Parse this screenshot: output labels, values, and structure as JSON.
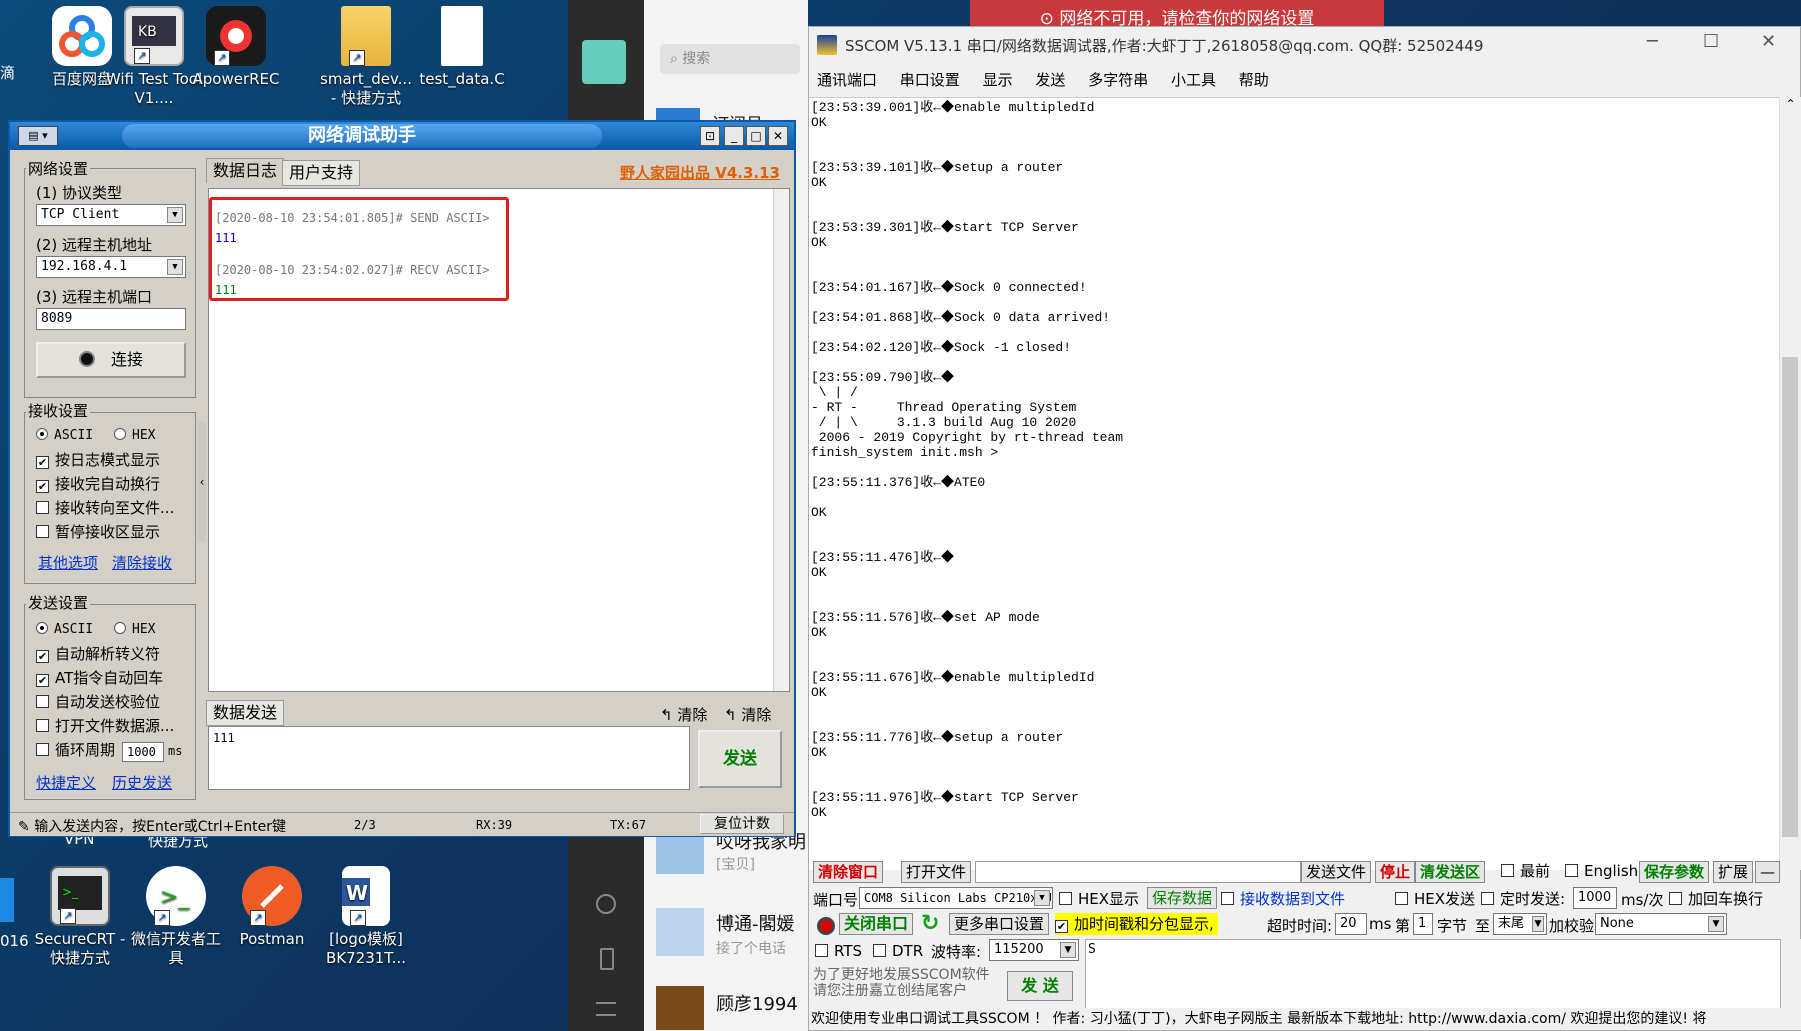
{
  "desktop": {
    "icons": [
      {
        "label": "百度网盘",
        "icon": "baidu-netdisk-icon"
      },
      {
        "label": "Wifi Test Tool V1....",
        "icon": "wifi-tool-icon"
      },
      {
        "label": "ApowerREC",
        "icon": "apowerrec-icon"
      },
      {
        "label": "smart_dev... - 快捷方式",
        "icon": "folder-icon"
      },
      {
        "label": "test_data.C",
        "icon": "file-icon"
      },
      {
        "label": "SecureCRT - 快捷方式",
        "icon": "securecrt-icon"
      },
      {
        "label": "微信开发者工具",
        "icon": "wechat-dev-icon"
      },
      {
        "label": "Postman",
        "icon": "postman-icon"
      },
      {
        "label": "[logo模板] BK7231T...",
        "icon": "word-icon"
      }
    ],
    "partial_labels": {
      "left_top": "滴",
      "vpn": "VPN",
      "shortcut2": "快捷方式",
      "left_bottom": "016"
    },
    "search_placeholder": "搜索",
    "alert": "网络不可用，请检查你的网络设置",
    "chats": [
      {
        "name": "订阅号",
        "preview": ""
      },
      {
        "name": "哎呀我家明",
        "preview": "[宝贝]"
      },
      {
        "name": "博通-閣媛",
        "preview": "接了个电话"
      },
      {
        "name": "顾彦1994",
        "preview": ""
      }
    ]
  },
  "netassist": {
    "title": "网络调试助手",
    "net_settings": "网络设置",
    "protocol_label": "(1) 协议类型",
    "protocol_value": "TCP Client",
    "host_label": "(2) 远程主机地址",
    "host_value": "192.168.4.1",
    "port_label": "(3) 远程主机端口",
    "port_value": "8089",
    "connect": "连接",
    "recv_settings": "接收设置",
    "ascii": "ASCII",
    "hex": "HEX",
    "recv_opts": [
      "按日志模式显示",
      "接收完自动换行",
      "接收转向至文件...",
      "暂停接收区显示"
    ],
    "recv_checked": [
      true,
      true,
      false,
      false
    ],
    "other_opts": "其他选项",
    "clear_recv": "清除接收",
    "send_settings": "发送设置",
    "send_opts": [
      "自动解析转义符",
      "AT指令自动回车",
      "自动发送校验位",
      "打开文件数据源...",
      "循环周期"
    ],
    "send_checked": [
      true,
      true,
      false,
      false,
      false
    ],
    "cycle_value": "1000",
    "cycle_unit": "ms",
    "shortcut_def": "快捷定义",
    "history_send": "历史发送",
    "tab_log": "数据日志",
    "tab_support": "用户支持",
    "brand": "野人家园出品 V4.3.13",
    "log": [
      {
        "header": "[2020-08-10 23:54:01.805]# SEND ASCII>",
        "body": "111"
      },
      {
        "header": "[2020-08-10 23:54:02.027]# RECV ASCII>",
        "body": "111"
      }
    ],
    "send_tab": "数据发送",
    "clear1": "清除",
    "clear2": "清除",
    "send_text": "111",
    "send_btn": "发送",
    "status_hint": "输入发送内容，按Enter或Ctrl+Enter键",
    "status_page": "2/3",
    "status_rx": "RX:39",
    "status_tx": "TX:67",
    "reset_count": "复位计数"
  },
  "sscom": {
    "title": "SSCOM V5.13.1 串口/网络数据调试器,作者:大虾丁丁,2618058@qq.com. QQ群: 52502449",
    "menu": [
      "通讯端口",
      "串口设置",
      "显示",
      "发送",
      "多字符串",
      "小工具",
      "帮助"
    ],
    "log": [
      "[23:53:39.001]收←◆enable multipledId\nOK",
      "[23:53:39.101]收←◆setup a router\nOK",
      "[23:53:39.301]收←◆start TCP Server\nOK",
      "[23:54:01.167]收←◆Sock 0 connected!",
      "[23:54:01.868]收←◆Sock 0 data arrived!",
      "[23:54:02.120]收←◆Sock -1 closed!",
      "[23:55:09.790]收←◆\n \\ | /\n- RT -     Thread Operating System\n / | \\     3.1.3 build Aug 10 2020\n 2006 - 2019 Copyright by rt-thread team\nfinish_system init.msh >",
      "[23:55:11.376]收←◆ATE0\n\nOK",
      "[23:55:11.476]收←◆\nOK",
      "[23:55:11.576]收←◆set AP mode\nOK",
      "[23:55:11.676]收←◆enable multipledId\nOK",
      "[23:55:11.776]收←◆setup a router\nOK",
      "[23:55:11.976]收←◆start TCP Server\nOK"
    ],
    "clear_window": "清除窗口",
    "open_file": "打开文件",
    "send_file": "发送文件",
    "stop": "停止",
    "clear_send": "清发送区",
    "latest": "最前",
    "english": "English",
    "save_params": "保存参数",
    "expand": "扩展",
    "dash": "—",
    "port_label": "端口号",
    "port_value": "COM8 Silicon Labs CP210x U",
    "hex_display": "HEX显示",
    "save_data": "保存数据",
    "recv_to_file": "接收数据到文件",
    "hex_send": "HEX发送",
    "timed_send": "定时发送:",
    "timed_value": "1000",
    "timed_unit": "ms/次",
    "add_crlf": "加回车换行",
    "close_port": "关闭串口",
    "more_settings": "更多串口设置",
    "timestamp": "加时间戳和分包显示,",
    "timeout_label": "超时时间:",
    "timeout_value": "20",
    "ms": "ms",
    "nth": "第",
    "nth_value": "1",
    "byte": "字节",
    "to": "至",
    "end": "末尾",
    "checksum": "加校验",
    "checksum_value": "None",
    "rts": "RTS",
    "dtr": "DTR",
    "baud_label": "波特率:",
    "baud_value": "115200",
    "send_area": "S",
    "promo": "为了更好地发展SSCOM软件\n请您注册嘉立创结尾客户",
    "send_btn": "发 送",
    "status": "欢迎使用专业串口调试工具SSCOM ！  作者: 习小猛(丁丁)，大虾电子网版主  最新版本下载地址: http://www.daxia.com/ 欢迎提出您的建议! 将"
  }
}
